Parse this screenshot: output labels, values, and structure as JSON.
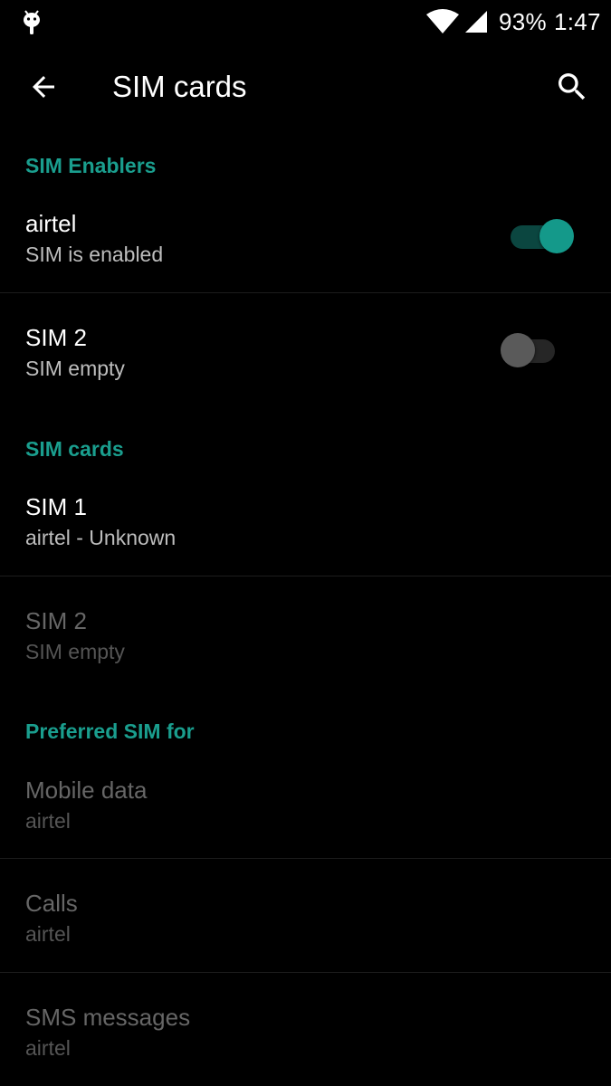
{
  "status_bar": {
    "notification_icon": "android-debug-icon",
    "battery": "93%",
    "time": "1:47"
  },
  "toolbar": {
    "title": "SIM cards",
    "back_icon": "arrow-left-icon",
    "search_icon": "search-icon"
  },
  "sections": {
    "enablers": {
      "header": "SIM Enablers",
      "items": [
        {
          "title": "airtel",
          "summary": "SIM is enabled",
          "enabled": true
        },
        {
          "title": "SIM 2",
          "summary": "SIM empty",
          "enabled": false
        }
      ]
    },
    "sim_cards": {
      "header": "SIM cards",
      "items": [
        {
          "title": "SIM 1",
          "summary": "airtel - Unknown"
        },
        {
          "title": "SIM 2",
          "summary": "SIM empty"
        }
      ]
    },
    "preferred": {
      "header": "Preferred SIM for",
      "items": [
        {
          "title": "Mobile data",
          "summary": "airtel"
        },
        {
          "title": "Calls",
          "summary": "airtel"
        },
        {
          "title": "SMS messages",
          "summary": "airtel"
        }
      ]
    }
  },
  "colors": {
    "accent": "#1a9e8e",
    "switch_on_thumb": "#14998a",
    "switch_on_track": "#0b4640",
    "switch_off_thumb": "#5a5a5a",
    "background": "#000000"
  }
}
